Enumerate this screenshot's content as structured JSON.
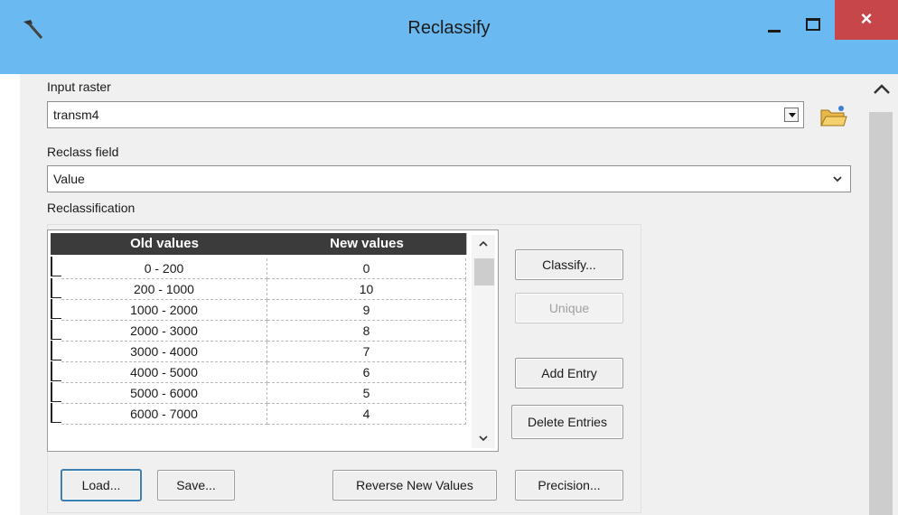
{
  "window": {
    "title": "Reclassify",
    "close_glyph": "×",
    "icons": {
      "app": "hammer-icon",
      "folder": "open-folder-icon"
    }
  },
  "input_raster": {
    "label": "Input raster",
    "value": "transm4"
  },
  "reclass_field": {
    "label": "Reclass field",
    "value": "Value"
  },
  "reclassification": {
    "label": "Reclassification",
    "columns": [
      "Old values",
      "New values"
    ],
    "rows": [
      {
        "old": "0 - 200",
        "new": "0"
      },
      {
        "old": "200 - 1000",
        "new": "10"
      },
      {
        "old": "1000 - 2000",
        "new": "9"
      },
      {
        "old": "2000 - 3000",
        "new": "8"
      },
      {
        "old": "3000 - 4000",
        "new": "7"
      },
      {
        "old": "4000 - 5000",
        "new": "6"
      },
      {
        "old": "5000 - 6000",
        "new": "5"
      },
      {
        "old": "6000 - 7000",
        "new": "4"
      }
    ]
  },
  "buttons": {
    "classify": "Classify...",
    "unique": "Unique",
    "add_entry": "Add Entry",
    "delete_entries": "Delete Entries",
    "load": "Load...",
    "save": "Save...",
    "reverse": "Reverse New Values",
    "precision": "Precision..."
  },
  "colors": {
    "titlebar": "#6ab9f0",
    "close": "#c7464a",
    "header": "#3b3b3b"
  }
}
